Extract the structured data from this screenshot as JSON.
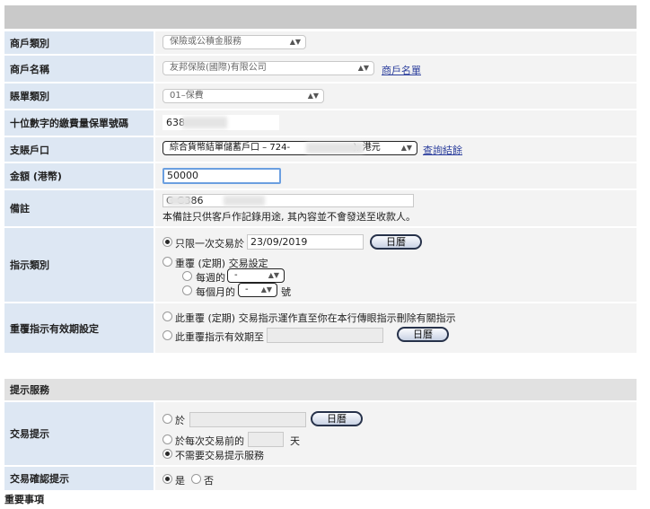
{
  "form": {
    "merchant_type": {
      "label": "商戶類別",
      "value": "保險或公積金服務"
    },
    "merchant_name": {
      "label": "商戶名稱",
      "value": "友邦保險(國際)有限公司",
      "link": "商戶名單"
    },
    "bill_type": {
      "label": "賬單類別",
      "value": "01–保費"
    },
    "policy_no": {
      "label": "十位數字的繳費量保單號碼",
      "value": "638"
    },
    "debit_account": {
      "label": "支賬戶口",
      "value_prefix": "綜合貨幣結單儲蓄戶口 – 724-",
      "value_suffix": "), 港元",
      "link": "查詢結餘"
    },
    "amount": {
      "label": "金額 (港幣)",
      "value": "50000"
    },
    "remarks": {
      "label": "備註",
      "value": "G        G386",
      "note": "本備註只供客戶作記錄用途, 其內容並不會發送至收款人。"
    },
    "instruction_type": {
      "label": "指示類別",
      "once_label": "只限一次交易於",
      "once_date": "23/09/2019",
      "calendar_label": "日曆",
      "recurring_label": "重覆 (定期) 交易設定",
      "weekly_label": "每週的",
      "weekly_value": "-",
      "monthly_label": "每個月的",
      "monthly_value": "-",
      "monthly_suffix": "號"
    },
    "validity": {
      "label": "重覆指示有效期設定",
      "until_cancel_label": "此重覆 (定期) 交易指示運作直至你在本行傳眼指示刪除有關指示",
      "until_date_label": "此重覆指示有效期至",
      "calendar_label": "日曆"
    }
  },
  "reminder": {
    "section_title": "提示服務",
    "tx_reminder": {
      "label": "交易提示",
      "on_label": "於",
      "calendar_label": "日曆",
      "days_before_label": "於每次交易前的",
      "days_suffix": "天",
      "no_service_label": "不需要交易提示服務"
    },
    "confirm": {
      "label": "交易確認提示",
      "yes": "是",
      "no": "否"
    }
  },
  "footer_title": "重要事項"
}
